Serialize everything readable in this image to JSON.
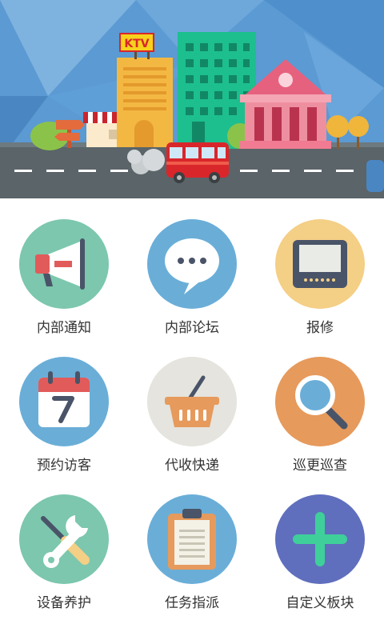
{
  "banner": {
    "ktv_sign": "KTV"
  },
  "colors": {
    "notice": "#7cc7ad",
    "forum": "#6aaed8",
    "repair": "#f4cf86",
    "visitor": "#6aaed8",
    "delivery": "#e5e4de",
    "patrol": "#e69a5c",
    "maintenance": "#7cc7ad",
    "task": "#6aaed8",
    "custom": "#5f6fbd"
  },
  "menu": [
    {
      "label": "内部通知",
      "icon": "megaphone-icon"
    },
    {
      "label": "内部论坛",
      "icon": "chat-bubble-icon"
    },
    {
      "label": "报修",
      "icon": "tv-icon"
    },
    {
      "label": "预约访客",
      "icon": "calendar-icon"
    },
    {
      "label": "代收快递",
      "icon": "basket-icon"
    },
    {
      "label": "巡更巡查",
      "icon": "magnifier-icon"
    },
    {
      "label": "设备养护",
      "icon": "tools-icon"
    },
    {
      "label": "任务指派",
      "icon": "clipboard-icon"
    },
    {
      "label": "自定义板块",
      "icon": "plus-icon"
    }
  ]
}
